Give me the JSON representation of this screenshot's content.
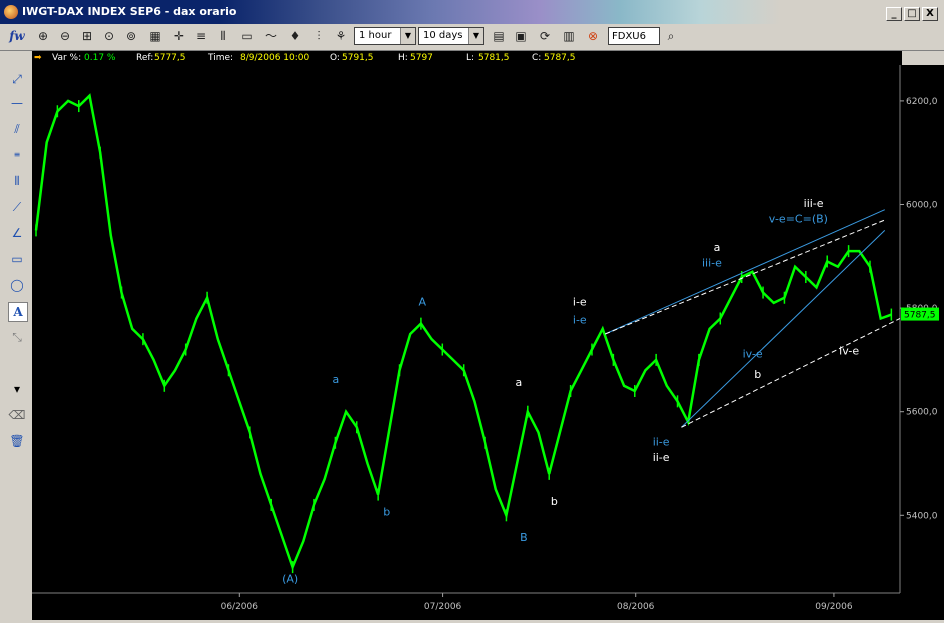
{
  "window": {
    "title": "IWGT-DAX INDEX SEP6 - dax orario",
    "minimize": "_",
    "restore": "□",
    "close": "X"
  },
  "toolbar": {
    "logo_text": "fw",
    "interval": "1 hour",
    "range": "10 days",
    "symbol": "FDXU6"
  },
  "infobar": {
    "var_label": "Var %:",
    "var_value": "0.17 %",
    "ref_label": "Ref:",
    "ref_value": "5777,5",
    "time_label": "Time:",
    "time_value": "8/9/2006 10:00",
    "o_label": "O:",
    "o_value": "5791,5",
    "h_label": "H:",
    "h_value": "5797",
    "l_label": "L:",
    "l_value": "5781,5",
    "c_label": "C:",
    "c_value": "5787,5"
  },
  "colors": {
    "price": "#00ff00",
    "wave_blue": "#3a9ae0",
    "wave_white": "#ffffff",
    "background": "#000000"
  },
  "chart_data": {
    "type": "line",
    "series": [
      {
        "x": [
          0,
          3,
          6,
          9,
          12,
          15,
          18,
          21,
          24,
          27,
          30,
          33,
          36,
          39,
          42,
          45,
          48,
          51,
          54,
          57,
          60,
          63,
          66,
          69,
          72,
          75,
          78,
          81,
          84,
          87,
          90,
          93,
          96,
          99,
          102,
          105,
          108,
          111,
          114,
          117,
          120,
          123,
          126,
          129,
          132,
          135,
          138,
          141,
          144,
          147,
          150,
          153,
          156,
          159,
          162,
          165,
          168,
          171,
          174,
          177,
          180,
          183,
          186,
          189,
          192,
          195,
          198,
          201,
          204,
          207,
          210,
          213,
          216,
          219,
          222,
          225,
          228,
          231,
          234,
          237,
          240
        ],
        "values": [
          5950,
          6120,
          6180,
          6200,
          6190,
          6210,
          6100,
          5940,
          5830,
          5760,
          5740,
          5700,
          5650,
          5680,
          5720,
          5780,
          5820,
          5740,
          5680,
          5620,
          5560,
          5480,
          5420,
          5360,
          5300,
          5350,
          5420,
          5470,
          5540,
          5600,
          5570,
          5500,
          5440,
          5560,
          5680,
          5750,
          5770,
          5740,
          5720,
          5700,
          5680,
          5620,
          5540,
          5450,
          5400,
          5500,
          5600,
          5560,
          5480,
          5560,
          5640,
          5680,
          5720,
          5760,
          5700,
          5650,
          5640,
          5680,
          5700,
          5650,
          5620,
          5580,
          5700,
          5760,
          5780,
          5820,
          5860,
          5870,
          5830,
          5810,
          5820,
          5880,
          5860,
          5840,
          5890,
          5880,
          5910,
          5910,
          5880,
          5780,
          5787.5
        ]
      }
    ],
    "yticks": [
      5400,
      5600,
      5800,
      6000,
      6200
    ],
    "ytick_labels": [
      "5400,0",
      "5600,0",
      "5800,0",
      "6000,0",
      "6200,0"
    ],
    "ylim": [
      5250,
      6250
    ],
    "xticks": [
      40,
      80,
      118,
      157
    ],
    "xtick_labels": [
      "06/2006",
      "07/2006",
      "08/2006",
      "09/2006"
    ],
    "xlim": [
      0,
      170
    ],
    "last_value_label": "5787,5",
    "annotations": [
      {
        "text": "(A)",
        "x": 50,
        "y": 5270,
        "color": "blue"
      },
      {
        "text": "a",
        "x": 59,
        "y": 5655,
        "color": "blue"
      },
      {
        "text": "b",
        "x": 69,
        "y": 5400,
        "color": "blue"
      },
      {
        "text": "A",
        "x": 76,
        "y": 5805,
        "color": "blue"
      },
      {
        "text": "a",
        "x": 95,
        "y": 5650,
        "color": "white"
      },
      {
        "text": "B",
        "x": 96,
        "y": 5350,
        "color": "blue"
      },
      {
        "text": "b",
        "x": 102,
        "y": 5420,
        "color": "white"
      },
      {
        "text": "i-e",
        "x": 107,
        "y": 5805,
        "color": "white"
      },
      {
        "text": "i-e",
        "x": 107,
        "y": 5770,
        "color": "blue"
      },
      {
        "text": "ii-e",
        "x": 123,
        "y": 5535,
        "color": "blue"
      },
      {
        "text": "ii-e",
        "x": 123,
        "y": 5505,
        "color": "white"
      },
      {
        "text": "a",
        "x": 134,
        "y": 5910,
        "color": "white"
      },
      {
        "text": "iii-e",
        "x": 133,
        "y": 5880,
        "color": "blue"
      },
      {
        "text": "iv-e",
        "x": 141,
        "y": 5705,
        "color": "blue"
      },
      {
        "text": "b",
        "x": 142,
        "y": 5665,
        "color": "white"
      },
      {
        "text": "v-e=C=(B)",
        "x": 150,
        "y": 5965,
        "color": "blue"
      },
      {
        "text": "iii-e",
        "x": 153,
        "y": 5995,
        "color": "white"
      },
      {
        "text": "iv-e",
        "x": 160,
        "y": 5710,
        "color": "white"
      }
    ]
  }
}
